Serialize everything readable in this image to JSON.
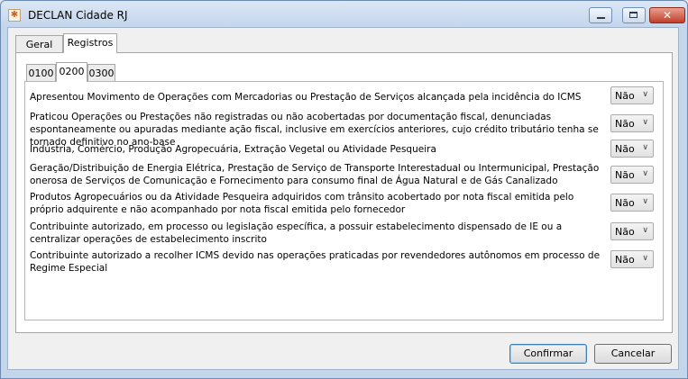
{
  "window": {
    "title": "DECLAN Cidade RJ",
    "app_icon_glyph": "✱",
    "close_glyph": "✕"
  },
  "main_tabs": [
    {
      "label": "Geral",
      "active": false
    },
    {
      "label": "Registros",
      "active": true
    }
  ],
  "sub_tabs": [
    {
      "label": "0100",
      "active": false
    },
    {
      "label": "0200",
      "active": true
    },
    {
      "label": "0300",
      "active": false
    }
  ],
  "questions": [
    {
      "text": "Apresentou Movimento de Operações com Mercadorias ou Prestação de Serviços alcançada pela incidência do ICMS",
      "value": "Não"
    },
    {
      "text": "Praticou Operações ou Prestações não registradas ou não acobertadas por documentação fiscal, denunciadas espontaneamente ou apuradas mediante ação fiscal, inclusive em exercícios anteriores, cujo crédito tributário tenha se tornado definitivo no ano-base",
      "value": "Não"
    },
    {
      "text": "Indústria, Comércio, Produção Agropecuária, Extração Vegetal ou Atividade Pesqueira",
      "value": "Não"
    },
    {
      "text": "Geração/Distribuição de Energia Elétrica, Prestação de Serviço de Transporte Interestadual ou Intermunicipal, Prestação onerosa de Serviços de Comunicação e Fornecimento para consumo final de Água Natural e de Gás Canalizado",
      "value": "Não"
    },
    {
      "text": "Produtos Agropecuários ou da Atividade Pesqueira adquiridos com trânsito acobertado por nota fiscal emitida pelo próprio adquirente e não acompanhado por nota fiscal emitida pelo fornecedor",
      "value": "Não"
    },
    {
      "text": "Contribuinte autorizado, em processo ou legislação específica, a possuir estabelecimento dispensado de IE ou a centralizar operações de estabelecimento inscrito",
      "value": "Não"
    },
    {
      "text": "Contribuinte autorizado a recolher ICMS devido nas operações praticadas por revendedores autônomos em processo de Regime Especial",
      "value": "Não"
    }
  ],
  "buttons": {
    "confirm": "Confirmar",
    "cancel": "Cancelar"
  }
}
